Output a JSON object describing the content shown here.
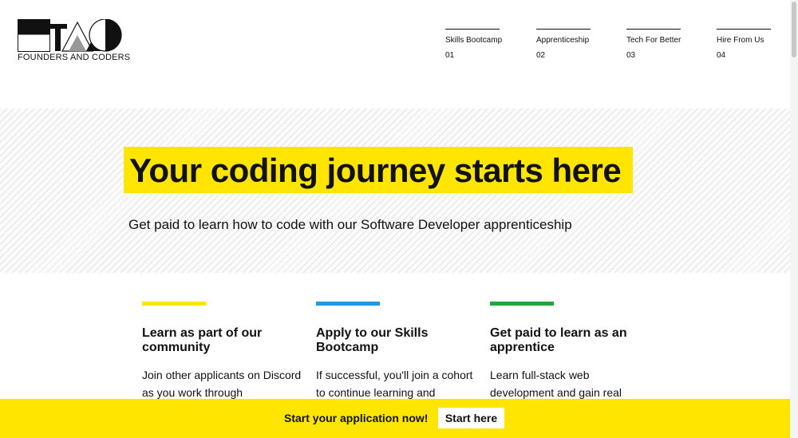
{
  "brand": {
    "name": "FOUNDERS AND CODERS"
  },
  "nav": {
    "items": [
      {
        "label": "Skills Bootcamp",
        "number": "01"
      },
      {
        "label": "Apprenticeship",
        "number": "02"
      },
      {
        "label": "Tech For Better",
        "number": "03"
      },
      {
        "label": "Hire From Us",
        "number": "04"
      }
    ]
  },
  "hero": {
    "title": "Your coding journey starts here",
    "subtitle": "Get paid to learn how to code with our Software Developer apprenticeship",
    "highlight_color": "#ffe500"
  },
  "cards": [
    {
      "title": "Learn as part of our community",
      "body": "Join other applicants on Discord as you work through",
      "accent_color": "#ffe500"
    },
    {
      "title": "Apply to our Skills Bootcamp",
      "body": "If successful, you'll join a cohort to continue learning and",
      "accent_color": "#1e9be0"
    },
    {
      "title": "Get paid to learn as an apprentice",
      "body": "Learn full-stack web development and gain real",
      "accent_color": "#1fa83a"
    }
  ],
  "cta": {
    "text": "Start your application now!",
    "button_label": "Start here",
    "background_color": "#ffe500"
  }
}
